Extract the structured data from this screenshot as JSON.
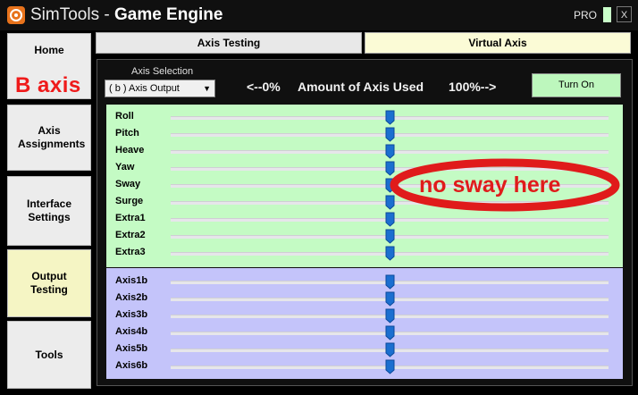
{
  "window": {
    "title_prefix": "SimTools - ",
    "title_bold": "Game Engine",
    "pro_label": "PRO",
    "close_label": "X"
  },
  "nav": {
    "items": [
      {
        "label": "Home"
      },
      {
        "label": "Axis Assignments"
      },
      {
        "label": "Interface Settings"
      },
      {
        "label": "Output Testing",
        "active": true
      },
      {
        "label": "Tools"
      }
    ]
  },
  "overlay_annotation_b_axis": "B axis",
  "tabs": [
    {
      "label": "Axis Testing"
    },
    {
      "label": "Virtual Axis",
      "active": true
    }
  ],
  "axis_selection": {
    "label": "Axis Selection",
    "value": "( b ) Axis Output"
  },
  "header": {
    "left": "<--0%",
    "middle": "Amount of Axis Used",
    "right": "100%-->"
  },
  "turn_on_label": "Turn On",
  "green_axes": [
    {
      "label": "Roll",
      "value_pct": 50
    },
    {
      "label": "Pitch",
      "value_pct": 50
    },
    {
      "label": "Heave",
      "value_pct": 50
    },
    {
      "label": "Yaw",
      "value_pct": 50
    },
    {
      "label": "Sway",
      "value_pct": 50
    },
    {
      "label": "Surge",
      "value_pct": 50
    },
    {
      "label": "Extra1",
      "value_pct": 50
    },
    {
      "label": "Extra2",
      "value_pct": 50
    },
    {
      "label": "Extra3",
      "value_pct": 50
    }
  ],
  "blue_axes": [
    {
      "label": "Axis1b",
      "value_pct": 50
    },
    {
      "label": "Axis2b",
      "value_pct": 50
    },
    {
      "label": "Axis3b",
      "value_pct": 50
    },
    {
      "label": "Axis4b",
      "value_pct": 50
    },
    {
      "label": "Axis5b",
      "value_pct": 50
    },
    {
      "label": "Axis6b",
      "value_pct": 50
    }
  ],
  "overlay_annotation_note": "no sway here",
  "colors": {
    "green_section": "#c4fbc4",
    "blue_section": "#c4c4fa",
    "active_tab": "#fbfbd6",
    "turn_on_button": "#bdf7bd",
    "annotation_red": "#e01b1b",
    "thumb_blue": "#1b6fd0"
  }
}
